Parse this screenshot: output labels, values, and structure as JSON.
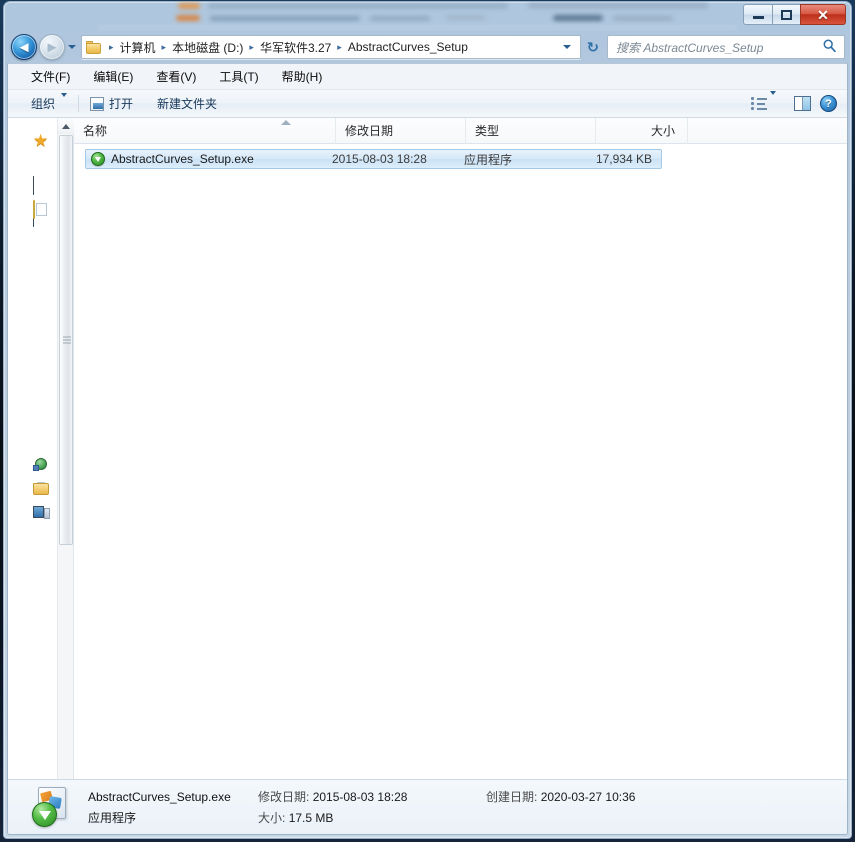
{
  "window": {
    "controls": {
      "minimize_label": "—",
      "maximize_label": "",
      "close_label": "✕"
    }
  },
  "navbar": {
    "back_arrow": "◄",
    "forward_arrow": "►",
    "breadcrumb": {
      "separator": "▸",
      "items": [
        {
          "label": "计算机"
        },
        {
          "label": "本地磁盘 (D:)"
        },
        {
          "label": "华军软件3.27"
        },
        {
          "label": "AbstractCurves_Setup"
        }
      ]
    },
    "refresh_label": "↻",
    "search": {
      "placeholder": "搜索 AbstractCurves_Setup",
      "value": "",
      "icon": "🔍"
    }
  },
  "menubar": {
    "items": [
      {
        "label": "文件(F)"
      },
      {
        "label": "编辑(E)"
      },
      {
        "label": "查看(V)"
      },
      {
        "label": "工具(T)"
      },
      {
        "label": "帮助(H)"
      }
    ]
  },
  "toolbar": {
    "organize_label": "组织",
    "open_label": "打开",
    "new_folder_label": "新建文件夹",
    "help_label": "?"
  },
  "nav_pane": {
    "icons": [
      {
        "name": "favorites-icon",
        "glyph": "★"
      },
      {
        "name": "desktop-icon"
      },
      {
        "name": "libraries-icon"
      },
      {
        "name": "network-icon"
      },
      {
        "name": "folder-icon"
      },
      {
        "name": "computer-icon"
      }
    ]
  },
  "file_list": {
    "columns": [
      {
        "key": "name",
        "label": "名称"
      },
      {
        "key": "date",
        "label": "修改日期"
      },
      {
        "key": "type",
        "label": "类型"
      },
      {
        "key": "size",
        "label": "大小"
      }
    ],
    "rows": [
      {
        "name": "AbstractCurves_Setup.exe",
        "date": "2015-08-03 18:28",
        "type": "应用程序",
        "size": "17,934 KB",
        "selected": true,
        "icon": "download-arrow-icon"
      }
    ]
  },
  "details_pane": {
    "filename": "AbstractCurves_Setup.exe",
    "modified_label": "修改日期:",
    "modified_value": "2015-08-03 18:28",
    "created_label": "创建日期:",
    "created_value": "2020-03-27 10:36",
    "type_value": "应用程序",
    "size_label": "大小:",
    "size_value": "17.5 MB"
  },
  "colors": {
    "selection_border": "#a4c9e8",
    "accent_blue": "#2f6fa8",
    "close_red": "#bc2f1a",
    "exe_green": "#4fb845"
  }
}
